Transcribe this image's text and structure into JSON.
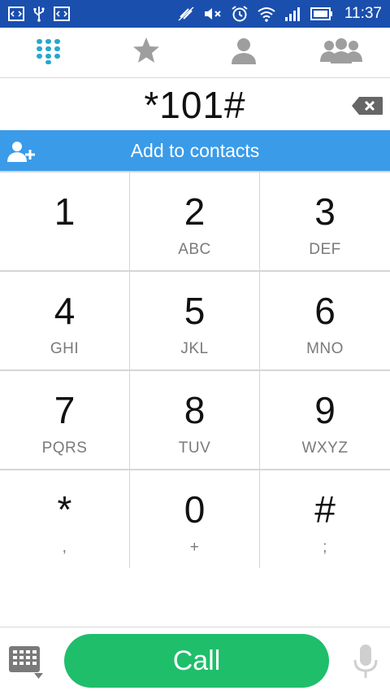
{
  "status_bar": {
    "time": "11:37",
    "left_icons": [
      "code-box-icon",
      "usb-icon",
      "code-box-icon"
    ],
    "right_icons": [
      "sync-off-icon",
      "volume-mute-icon",
      "alarm-icon",
      "wifi-icon",
      "signal-icon",
      "battery-icon"
    ],
    "background": "#1a4fae"
  },
  "tabs": [
    {
      "id": "dialpad",
      "icon": "dialpad-icon",
      "active": true,
      "color": "#26a8cf"
    },
    {
      "id": "favorites",
      "icon": "star-icon",
      "active": false,
      "color": "#9e9e9e"
    },
    {
      "id": "contacts",
      "icon": "person-icon",
      "active": false,
      "color": "#9e9e9e"
    },
    {
      "id": "groups",
      "icon": "group-icon",
      "active": false,
      "color": "#9e9e9e"
    }
  ],
  "dialer": {
    "number": "*101#",
    "backspace_icon": "backspace-icon"
  },
  "add_contacts": {
    "label": "Add to contacts",
    "icon": "add-person-icon",
    "background": "#3a9be9"
  },
  "keypad": {
    "keys": [
      {
        "digit": "1",
        "letters": ""
      },
      {
        "digit": "2",
        "letters": "ABC"
      },
      {
        "digit": "3",
        "letters": "DEF"
      },
      {
        "digit": "4",
        "letters": "GHI"
      },
      {
        "digit": "5",
        "letters": "JKL"
      },
      {
        "digit": "6",
        "letters": "MNO"
      },
      {
        "digit": "7",
        "letters": "PQRS"
      },
      {
        "digit": "8",
        "letters": "TUV"
      },
      {
        "digit": "9",
        "letters": "WXYZ"
      },
      {
        "digit": "*",
        "letters": ","
      },
      {
        "digit": "0",
        "letters": "+"
      },
      {
        "digit": "#",
        "letters": ";"
      }
    ]
  },
  "bottom_bar": {
    "call_label": "Call",
    "call_color": "#1fbe6b",
    "keypad_toggle_icon": "keypad-toggle-icon",
    "mic_icon": "microphone-icon"
  }
}
